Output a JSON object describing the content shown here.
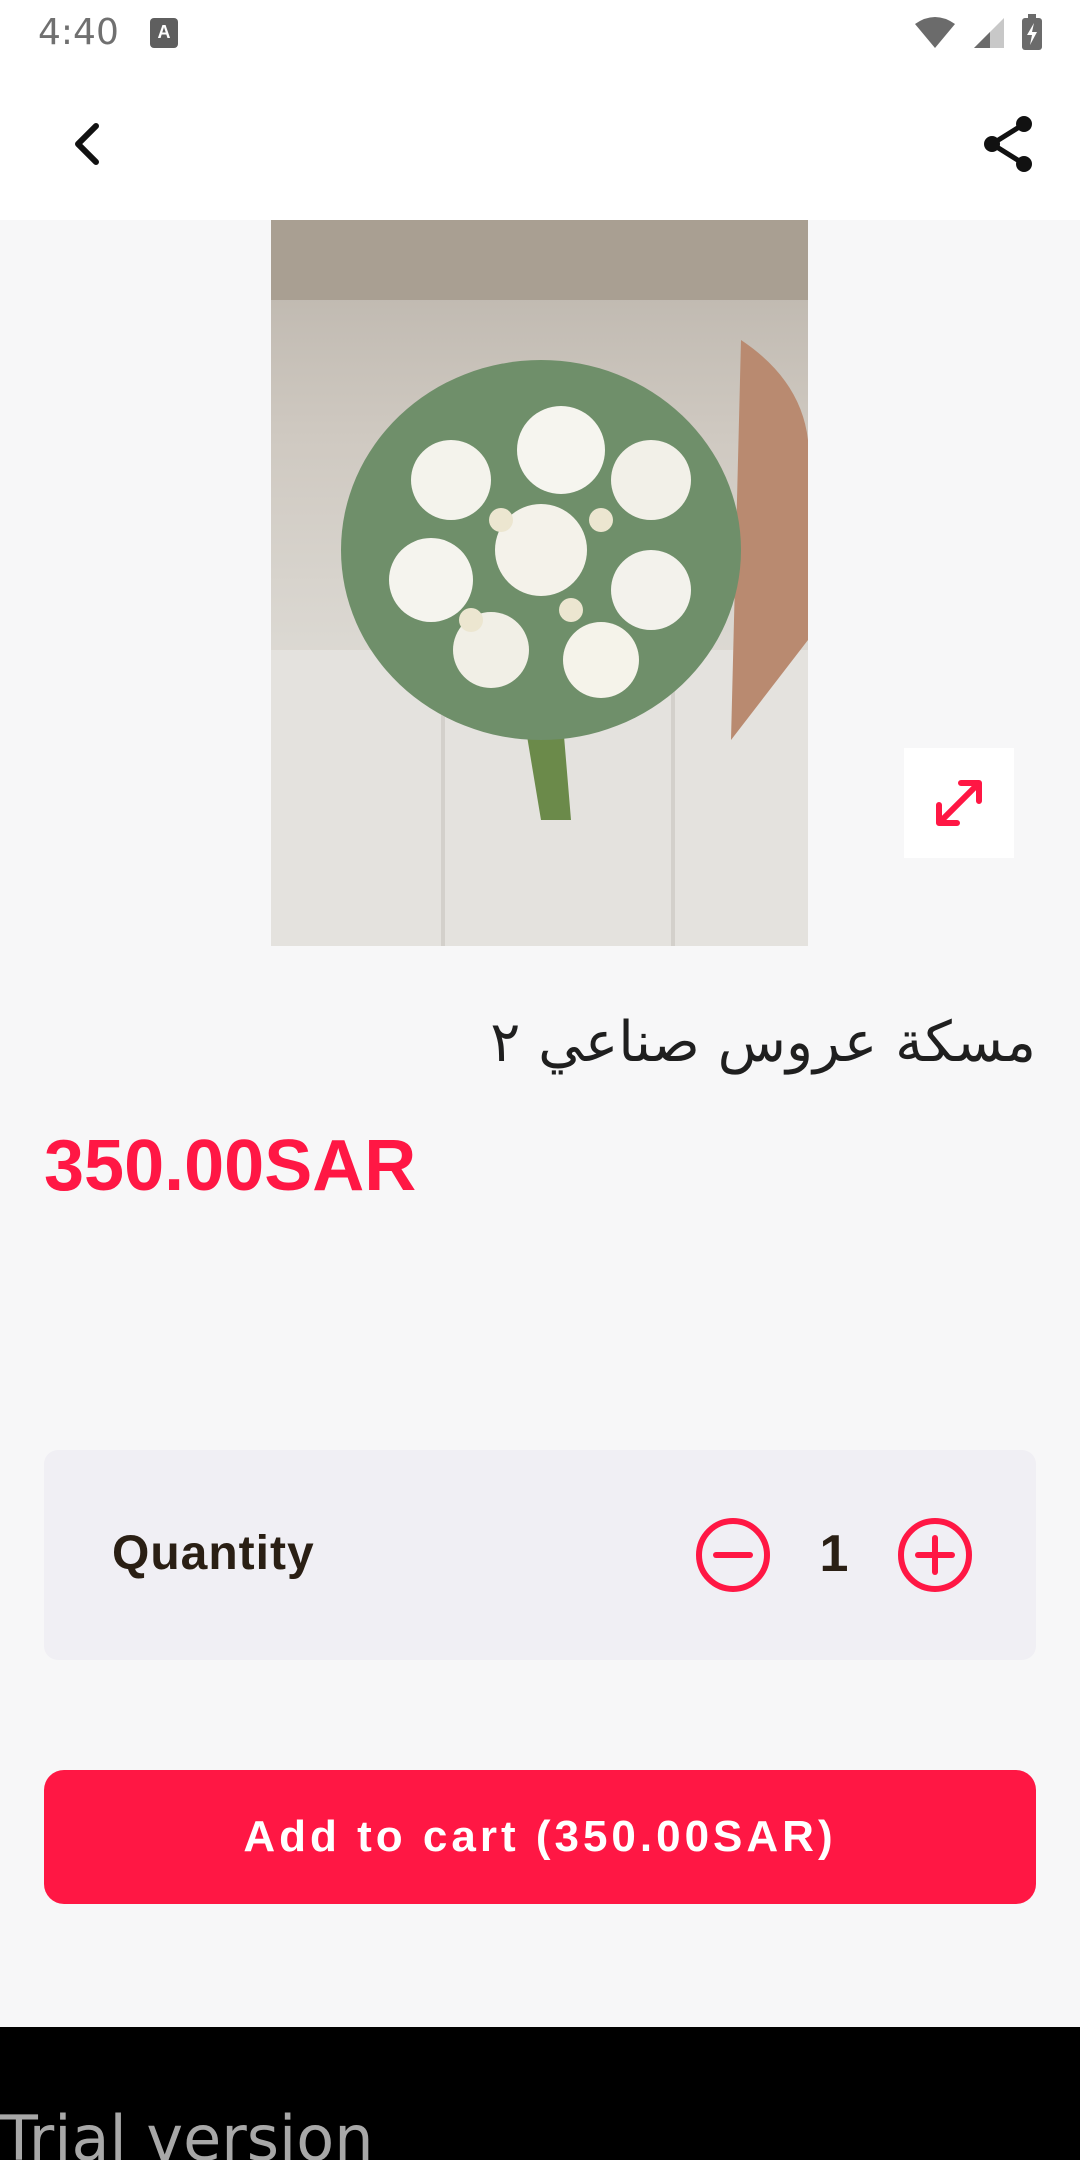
{
  "status_bar": {
    "time": "4:40",
    "notification_icon": "A",
    "icons": [
      "wifi-icon",
      "signal-icon",
      "battery-charging-icon"
    ]
  },
  "app_bar": {
    "back_icon": "chevron-left-icon",
    "share_icon": "share-icon"
  },
  "product": {
    "image_description": "bridal bouquet of white flowers",
    "expand_icon": "expand-diagonal-icon",
    "title": "مسكة عروس صناعي ٢",
    "price": "350.00SAR"
  },
  "quantity": {
    "label": "Quantity",
    "value": "1",
    "minus_icon": "minus-circle-icon",
    "plus_icon": "plus-circle-icon"
  },
  "cart": {
    "button_label": "Add to cart (350.00SAR)"
  },
  "footer": {
    "trial_text": "Trial version"
  },
  "colors": {
    "accent": "#ff1744",
    "background": "#f7f7f8",
    "card": "#f0eff4",
    "text_dark": "#2a1f14"
  }
}
